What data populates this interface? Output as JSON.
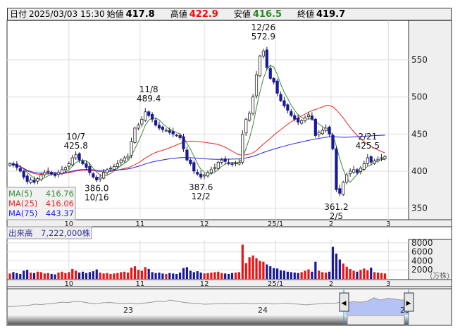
{
  "header": {
    "date_label": "日付",
    "datetime": "2025/03/03 15:30",
    "open_label": "始値",
    "open": "417.8",
    "high_label": "高値",
    "high": "422.9",
    "low_label": "安値",
    "low": "416.5",
    "close_label": "終値",
    "close": "419.7"
  },
  "colors": {
    "high": "#ff0000",
    "low": "#228b22",
    "ma5": "#3a8a3a",
    "ma25": "#ee2222",
    "ma75": "#2222ee",
    "up_volume": "#ee1111",
    "down_volume": "#1a1a99",
    "candle_down": "#1a1a99",
    "navigator_fill": "#b4c2f4"
  },
  "legend": [
    {
      "label": "MA(5)",
      "value": "416.76"
    },
    {
      "label": "MA(25)",
      "value": "416.06"
    },
    {
      "label": "MA(75)",
      "value": "443.37"
    }
  ],
  "volume_label": "出来高　7,222,000株",
  "chart_data": {
    "type": "candlestick",
    "price_axis": {
      "ticks": [
        "350",
        "400",
        "450",
        "500",
        "550"
      ],
      "range": [
        330,
        590
      ]
    },
    "x_ticks": [
      {
        "label": "10",
        "index": 17
      },
      {
        "label": "11",
        "index": 37.5
      },
      {
        "label": "12",
        "index": 56
      },
      {
        "label": "25/1",
        "index": 76.5
      },
      {
        "label": "2",
        "index": 92.5
      },
      {
        "label": "3",
        "index": 109
      }
    ],
    "close": [
      410,
      408,
      405,
      400,
      392,
      386,
      388,
      385,
      390,
      395,
      398,
      400,
      396,
      394,
      398,
      402,
      405,
      410,
      418,
      422,
      415,
      410,
      405,
      398,
      392,
      388,
      392,
      398,
      402,
      404,
      406,
      410,
      415,
      418,
      420,
      440,
      458,
      462,
      470,
      480,
      475,
      470,
      462,
      458,
      456,
      455,
      452,
      450,
      448,
      445,
      430,
      415,
      410,
      400,
      396,
      392,
      395,
      398,
      402,
      405,
      412,
      415,
      413,
      410,
      409,
      411,
      412,
      450,
      470,
      478,
      500,
      530,
      555,
      562,
      540,
      525,
      520,
      505,
      495,
      488,
      482,
      475,
      470,
      466,
      468,
      472,
      476,
      470,
      448,
      452,
      455,
      458,
      450,
      430,
      375,
      370,
      385,
      395,
      400,
      402,
      398,
      404,
      410,
      418,
      412,
      414,
      416,
      418,
      419.7
    ],
    "volume": [
      1200,
      1500,
      1300,
      1100,
      1800,
      2000,
      1400,
      1300,
      1600,
      1500,
      1200,
      1300,
      1100,
      1000,
      1400,
      1600,
      1300,
      1500,
      2200,
      1800,
      1400,
      1600,
      1300,
      1500,
      1700,
      2100,
      1400,
      1200,
      1300,
      1100,
      1200,
      1300,
      1500,
      1600,
      1400,
      2500,
      2800,
      2000,
      1800,
      2600,
      2200,
      1500,
      1300,
      1400,
      1200,
      1100,
      1300,
      1200,
      1100,
      1400,
      2400,
      2600,
      1800,
      1500,
      1700,
      1400,
      1200,
      1300,
      1400,
      1500,
      1600,
      1300,
      1200,
      1100,
      1300,
      1400,
      1500,
      7600,
      3500,
      4800,
      5200,
      4600,
      4000,
      3800,
      3200,
      2800,
      2400,
      2300,
      1900,
      1800,
      1600,
      1500,
      1400,
      1300,
      1500,
      1800,
      2100,
      1600,
      3800,
      1800,
      1500,
      1400,
      1600,
      7100,
      5600,
      4300,
      3400,
      2700,
      2200,
      1800,
      1600,
      2000,
      2300,
      1900,
      2500,
      1500,
      1400,
      1300,
      1200
    ],
    "volume_axis": {
      "ticks": [
        "8000",
        "6000",
        "4000",
        "2000"
      ],
      "unit": "(万株)"
    },
    "annotations": [
      {
        "date": "10/7",
        "value": "425.8",
        "index": 19,
        "pos": "above"
      },
      {
        "date": "10/16",
        "value": "386.0",
        "index": 25,
        "pos": "below"
      },
      {
        "date": "11/8",
        "value": "489.4",
        "index": 40,
        "pos": "above"
      },
      {
        "date": "12/2",
        "value": "387.6",
        "index": 55,
        "pos": "below"
      },
      {
        "date": "12/26",
        "value": "572.9",
        "index": 73,
        "pos": "above"
      },
      {
        "date": "2/5",
        "value": "361.2",
        "index": 94,
        "pos": "below"
      },
      {
        "date": "2/21",
        "value": "425.5",
        "index": 103,
        "pos": "above"
      }
    ],
    "navigator": {
      "labels": [
        "23",
        "24",
        "25"
      ],
      "values": [
        30,
        31,
        33,
        34,
        38,
        37,
        40,
        42,
        45,
        44,
        48,
        46,
        42,
        40,
        43,
        44,
        42,
        41,
        42,
        40,
        42,
        44,
        48,
        47,
        52,
        48,
        44,
        42,
        41,
        38,
        39,
        40,
        41,
        40,
        41,
        42,
        40,
        41,
        42,
        39,
        40,
        42,
        40,
        38,
        36,
        38,
        40,
        42,
        41,
        44,
        43,
        47,
        45,
        48,
        60,
        52,
        58,
        56,
        52,
        54
      ]
    }
  }
}
